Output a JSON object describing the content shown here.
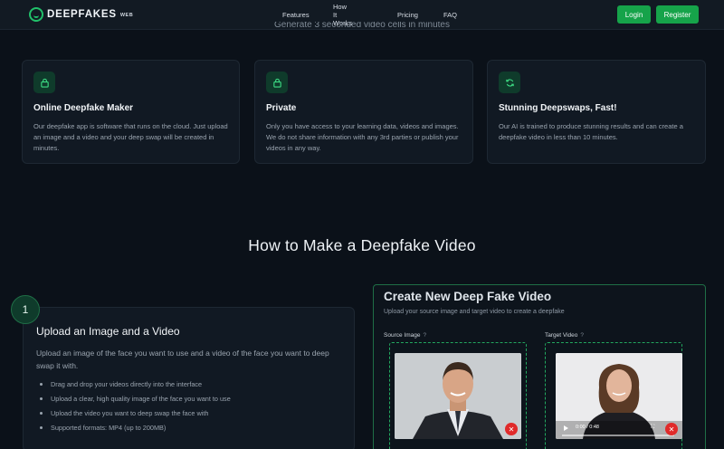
{
  "header": {
    "logo_text": "DEEPFAKES",
    "logo_sub": "WEB",
    "nav": [
      "Features",
      "How It Works",
      "Pricing",
      "FAQ"
    ],
    "login": "Login",
    "register": "Register"
  },
  "cut_heading": "Generate 3 seconded video cells in minutes",
  "features": [
    {
      "icon": "lock-icon",
      "title": "Online Deepfake Maker",
      "desc": "Our deepfake app is software that runs on the cloud. Just upload an image and a video and your deep swap will be created in minutes."
    },
    {
      "icon": "lock-icon",
      "title": "Private",
      "desc": "Only you have access to your learning data, videos and images. We do not share information with any 3rd parties or publish your videos in any way."
    },
    {
      "icon": "refresh-icon",
      "title": "Stunning Deepswaps, Fast!",
      "desc": "Our AI is trained to produce stunning results and can create a deepfake video in less than 10 minutes."
    }
  ],
  "how_title": "How to Make a Deepfake Video",
  "step": {
    "number": "1",
    "title": "Upload an Image and a Video",
    "desc": "Upload an image of the face you want to use and a video of the face you want to deep swap it with.",
    "bullets": [
      "Drag and drop your videos directly into the interface",
      "Upload a clear, high quality image of the face you want to use",
      "Upload the video you want to deep swap the face with",
      "Supported formats: MP4 (up to 200MB)"
    ]
  },
  "create": {
    "title": "Create New Deep Fake Video",
    "subtitle": "Upload your source image and target video to create a deepfake",
    "source_label": "Source Image",
    "target_label": "Target Video",
    "help": "?",
    "video_time": "0:00 / 0:48"
  },
  "colors": {
    "accent": "#16a34a",
    "background": "#0b1119",
    "card": "#111923",
    "danger": "#e02a2a"
  }
}
